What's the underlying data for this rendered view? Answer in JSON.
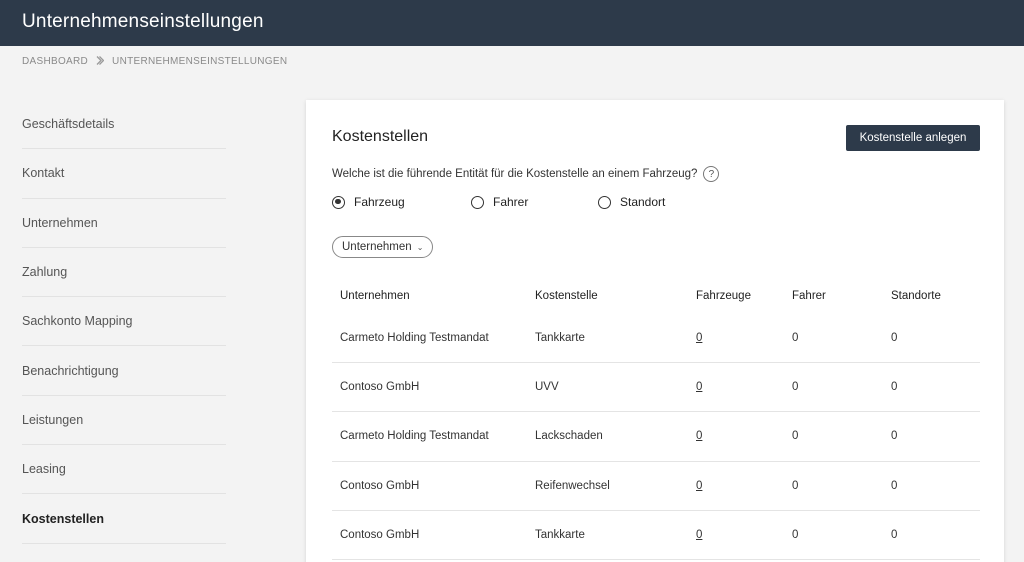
{
  "header": {
    "title": "Unternehmenseinstellungen"
  },
  "breadcrumb": {
    "items": [
      "DASHBOARD",
      "UNTERNEHMENSEINSTELLUNGEN"
    ],
    "separator": "chevron-right-icon"
  },
  "sidebar": {
    "items": [
      {
        "label": "Geschäftsdetails",
        "active": false
      },
      {
        "label": "Kontakt",
        "active": false
      },
      {
        "label": "Unternehmen",
        "active": false
      },
      {
        "label": "Zahlung",
        "active": false
      },
      {
        "label": "Sachkonto Mapping",
        "active": false
      },
      {
        "label": "Benachrichtigung",
        "active": false
      },
      {
        "label": "Leistungen",
        "active": false
      },
      {
        "label": "Leasing",
        "active": false
      },
      {
        "label": "Kostenstellen",
        "active": true
      }
    ]
  },
  "card": {
    "title": "Kostenstellen",
    "create_button": "Kostenstelle anlegen",
    "question": "Welche ist die führende Entität für die Kostenstelle an einem Fahrzeug?",
    "help_icon": "?",
    "radios": [
      {
        "label": "Fahrzeug",
        "checked": true
      },
      {
        "label": "Fahrer",
        "checked": false
      },
      {
        "label": "Standort",
        "checked": false
      }
    ],
    "filter": {
      "label": "Unternehmen",
      "icon": "chevron-down-icon",
      "chevron": "⌄"
    }
  },
  "table": {
    "headers": [
      "Unternehmen",
      "Kostenstelle",
      "Fahrzeuge",
      "Fahrer",
      "Standorte"
    ],
    "rows": [
      {
        "unternehmen": "Carmeto Holding Testmandat",
        "kostenstelle": "Tankkarte",
        "fahrzeuge": "0",
        "fahrer": "0",
        "standorte": "0"
      },
      {
        "unternehmen": "Contoso GmbH",
        "kostenstelle": "UVV",
        "fahrzeuge": "0",
        "fahrer": "0",
        "standorte": "0"
      },
      {
        "unternehmen": "Carmeto Holding Testmandat",
        "kostenstelle": "Lackschaden",
        "fahrzeuge": "0",
        "fahrer": "0",
        "standorte": "0"
      },
      {
        "unternehmen": "Contoso GmbH",
        "kostenstelle": "Reifenwechsel",
        "fahrzeuge": "0",
        "fahrer": "0",
        "standorte": "0"
      },
      {
        "unternehmen": "Contoso GmbH",
        "kostenstelle": "Tankkarte",
        "fahrzeuge": "0",
        "fahrer": "0",
        "standorte": "0"
      }
    ]
  },
  "colors": {
    "topbar": "#2d3a4a",
    "page_bg": "#f3f3f3",
    "button_bg": "#2d3a4a"
  }
}
